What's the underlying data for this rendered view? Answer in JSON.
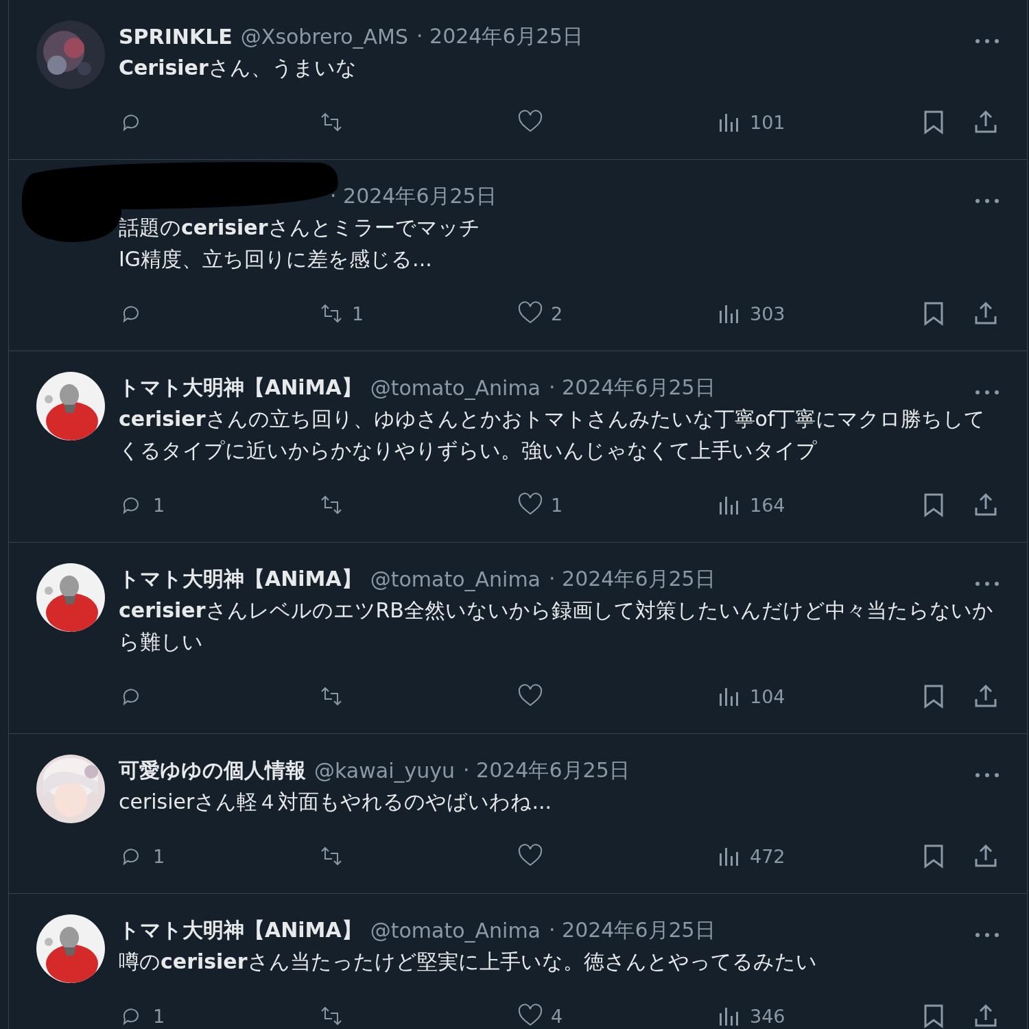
{
  "posts": [
    {
      "redacted": false,
      "name": "SPRINKLE",
      "handle": "@Xsobrero_AMS",
      "date": "· 2024年6月25日",
      "text": "**Cerisier**さん、うまいな",
      "views": "101"
    },
    {
      "redacted": true,
      "date": "· 2024年6月25日",
      "text": "話題の**cerisier**さんとミラーでマッチ\nIG精度、立ち回りに差を感じる...",
      "reposts": "1",
      "likes": "2",
      "views": "303"
    },
    {
      "redacted": false,
      "name": "トマト大明神【ANiMA】",
      "handle": "@tomato_Anima",
      "date": "· 2024年6月25日",
      "text": "**cerisier**さんの立ち回り、ゆゆさんとかおトマトさんみたいな丁寧of丁寧にマクロ勝ちしてくるタイプに近いからかなりやりずらい。強いんじゃなくて上手いタイプ",
      "replies": "1",
      "likes": "1",
      "views": "164"
    },
    {
      "redacted": false,
      "name": "トマト大明神【ANiMA】",
      "handle": "@tomato_Anima",
      "date": "· 2024年6月25日",
      "text": "**cerisier**さんレベルのエツRB全然いないから録画して対策したいんだけど中々当たらないから難しい",
      "views": "104"
    },
    {
      "redacted": false,
      "name": "可愛ゆゆの個人情報",
      "handle": "@kawai_yuyu",
      "date": "· 2024年6月25日",
      "text": "cerisierさん軽４対面もやれるのやばいわね...",
      "replies": "1",
      "views": "472"
    },
    {
      "redacted": false,
      "name": "トマト大明神【ANiMA】",
      "handle": "@tomato_Anima",
      "date": "· 2024年6月25日",
      "text": "噂の**cerisier**さん当たったけど堅実に上手いな。徳さんとやってるみたい",
      "replies": "1",
      "likes": "4",
      "views": "346"
    }
  ]
}
